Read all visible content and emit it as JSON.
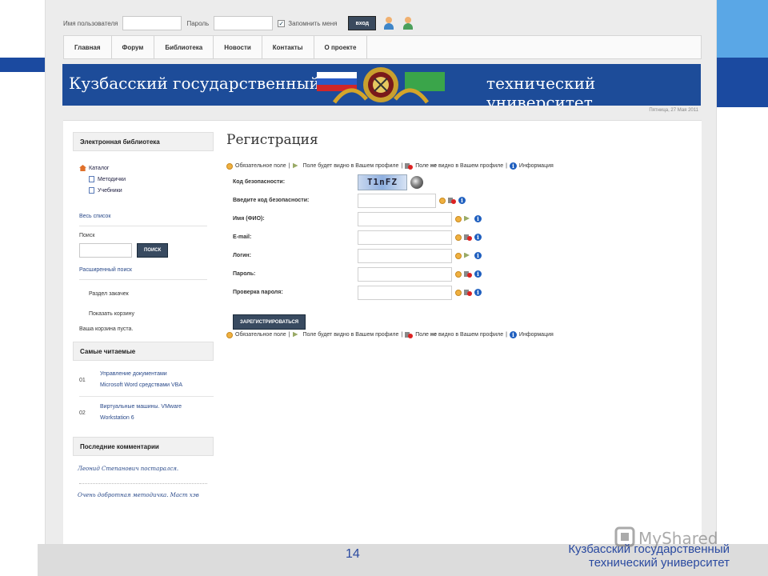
{
  "login": {
    "username_label": "Имя пользователя",
    "password_label": "Пароль",
    "remember_label": "Запомнить меня",
    "enter_button": "вход"
  },
  "nav": {
    "items": [
      "Главная",
      "Форум",
      "Библиотека",
      "Новости",
      "Контакты",
      "О проекте"
    ]
  },
  "banner": {
    "left_text": "Кузбасский государственный",
    "right_text": "технический университет"
  },
  "date": "Пятница, 27 Мая 2011",
  "sidebar": {
    "library_title": "Электронная библиотека",
    "tree": {
      "root": "Каталог",
      "children": [
        "Методички",
        "Учебники"
      ]
    },
    "full_list": "Весь список",
    "search_label": "Поиск",
    "search_button": "ПОИСК",
    "advanced_search": "Расширенный поиск",
    "downloads": "Раздел закачек",
    "show_cart": "Показать корзину",
    "cart_empty": "Ваша корзина пуста.",
    "popular_title": "Самые читаемые",
    "popular": [
      {
        "num": "01",
        "title_line1": "Управление документами",
        "title_line2": "Microsoft Word средствами VBA"
      },
      {
        "num": "02",
        "title_line1": "Виртуальные машины. VMware",
        "title_line2": "Workstation 6"
      }
    ],
    "comments_title": "Последние комментарии",
    "comments": [
      "Леонид Степанович постарался.",
      "Очень добротная методичка. Маст хэв"
    ]
  },
  "registration": {
    "title": "Регистрация",
    "legend": {
      "required": "Обязательное поле",
      "visible": "Поле будет видно в Вашем профиле",
      "hidden_prefix": "Поле ",
      "hidden_bold": "не",
      "hidden_suffix": " видно в Вашем профиле",
      "info": "Информация",
      "sep": "|"
    },
    "security_code_label": "Код безопасности:",
    "captcha_text": "T1nFZ",
    "fields": [
      {
        "label": "Введите код безопасности:",
        "value": ""
      },
      {
        "label": "Имя (ФИО):",
        "value": ""
      },
      {
        "label": "E-mail:",
        "value": ""
      },
      {
        "label": "Логин:",
        "value": ""
      },
      {
        "label": "Пароль:",
        "value": ""
      },
      {
        "label": "Проверка пароля:",
        "value": ""
      }
    ],
    "submit_button": "ЗАРЕГИСТРИРОВАТЬСЯ"
  },
  "slide": {
    "page_number": "14",
    "footer_line1": "Кузбасский государственный",
    "footer_line2": "технический университет",
    "watermark": "MyShared"
  },
  "colors": {
    "banner": "#1d4c99",
    "accent_dark_blue": "#1b4aa0",
    "accent_light_blue": "#5aa7e6",
    "button_dark": "#384a60",
    "link": "#2a4a8a"
  }
}
